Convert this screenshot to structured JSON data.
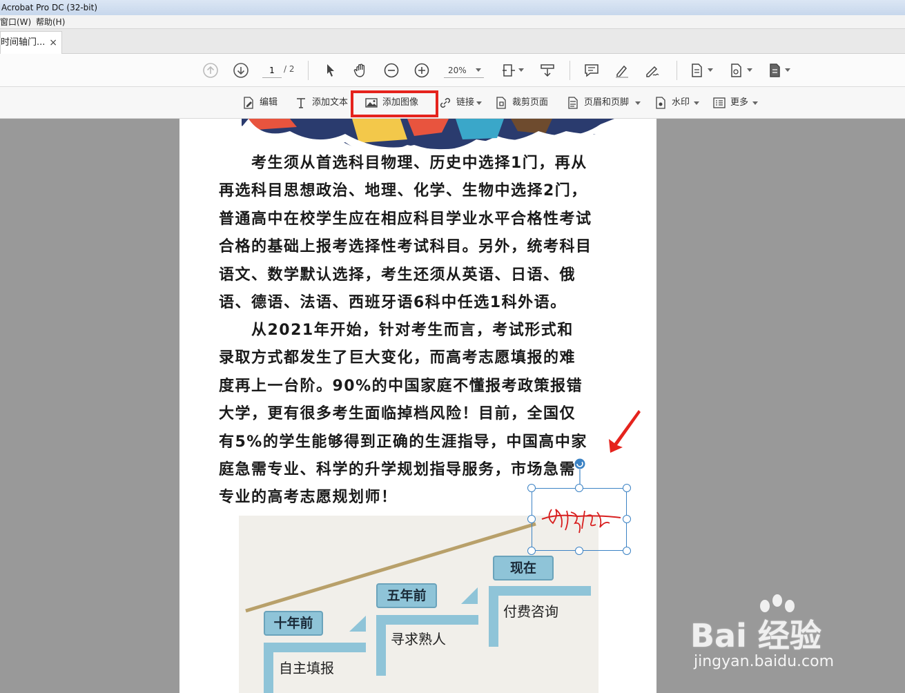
{
  "window": {
    "title": "Acrobat Pro DC (32-bit)"
  },
  "menu": {
    "items": [
      "窗口(W)",
      "帮助(H)"
    ]
  },
  "tab": {
    "label": "时间轴门...",
    "close": "×"
  },
  "toolbar": {
    "page_current": "1",
    "page_total": "/ 2",
    "zoom": "20%"
  },
  "edit_toolbar": {
    "items": [
      {
        "label": "编辑",
        "icon": "edit-pdf-icon"
      },
      {
        "label": "添加文本",
        "icon": "add-text-icon"
      },
      {
        "label": "添加图像",
        "icon": "add-image-icon"
      },
      {
        "label": "链接",
        "icon": "link-icon"
      },
      {
        "label": "裁剪页面",
        "icon": "crop-page-icon"
      },
      {
        "label": "页眉和页脚",
        "icon": "header-footer-icon"
      },
      {
        "label": "水印",
        "icon": "watermark-icon"
      },
      {
        "label": "更多",
        "icon": "more-icon"
      }
    ],
    "highlight_color": "#e5231d"
  },
  "document": {
    "paragraph1": [
      "　　考生须从首选科目物理、历史中选择1门，再从",
      "再选科目思想政治、地理、化学、生物中选择2门，",
      "普通高中在校学生应在相应科目学业水平合格性考试",
      "合格的基础上报考选择性考试科目。另外，统考科目",
      "语文、数学默认选择，考生还须从英语、日语、俄",
      "语、德语、法语、西班牙语6科中任选1科外语。"
    ],
    "paragraph2": [
      "　　从2021年开始，针对考生而言，考试形式和",
      "录取方式都发生了巨大变化，而高考志愿填报的难",
      "度再上一台阶。90%的中国家庭不懂报考政策报错",
      "大学，更有很多考生面临掉档风险！目前，全国仅",
      "有5%的学生能够得到正确的生涯指导，中国高中家",
      "庭急需专业、科学的升学规划指导服务，市场急需",
      "专业的高考志愿规划师！"
    ],
    "timeline": {
      "stages": [
        {
          "label": "十年前",
          "text": "自主填报"
        },
        {
          "label": "五年前",
          "text": "寻求熟人"
        },
        {
          "label": "现在",
          "text": "付费咨询"
        }
      ]
    }
  },
  "watermark": {
    "main": "Bai 经验",
    "sub": "jingyan.baidu.com"
  }
}
